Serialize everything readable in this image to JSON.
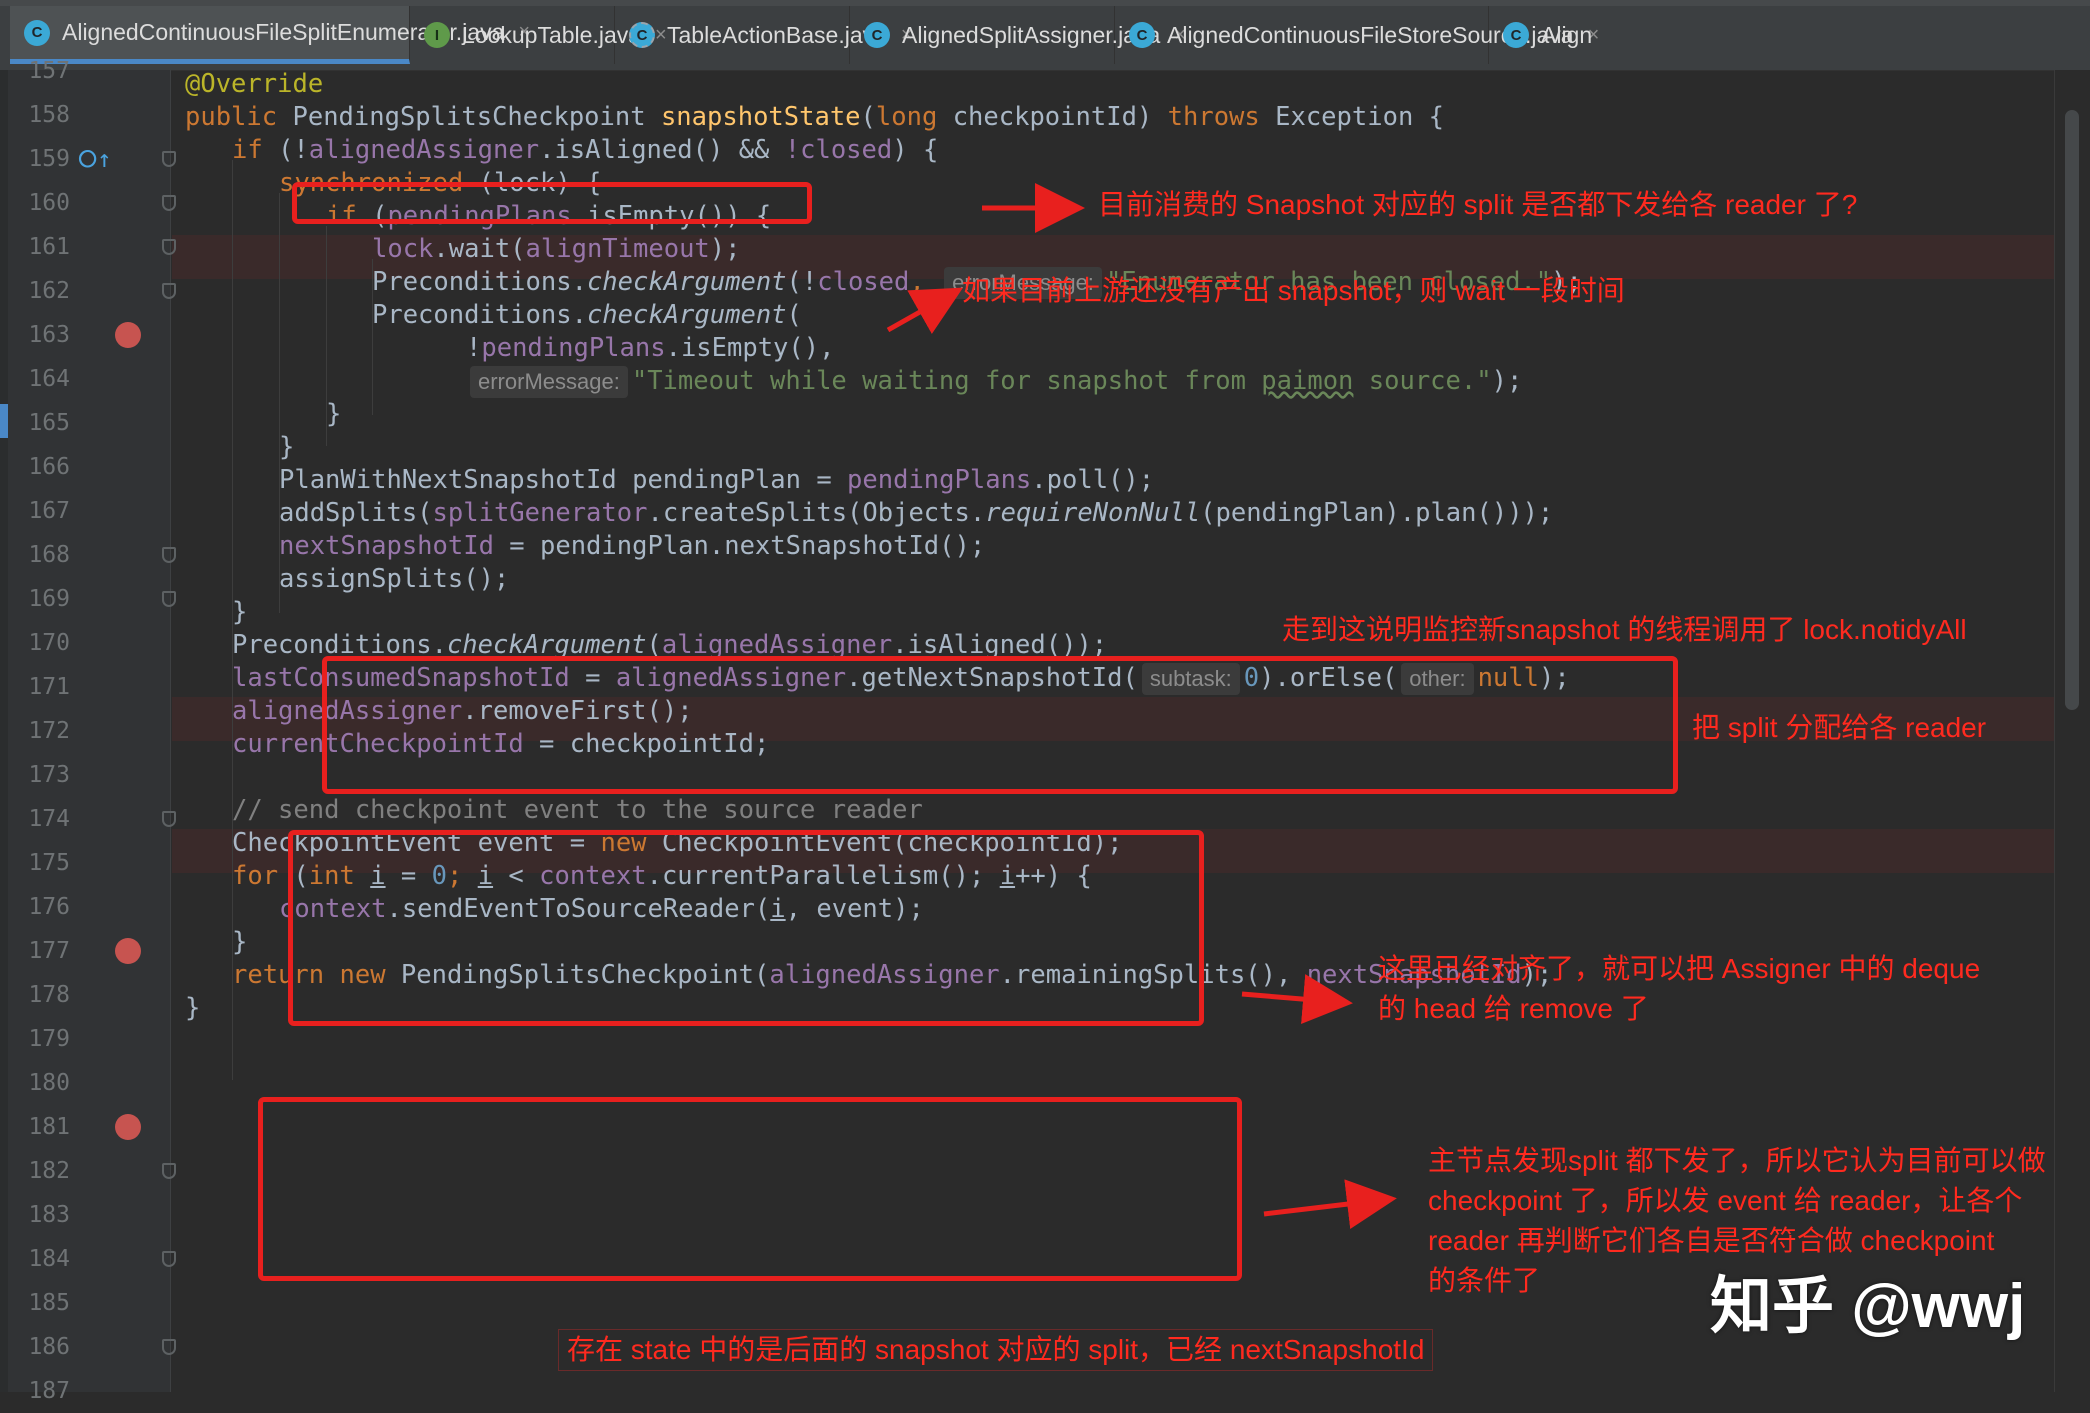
{
  "tabs": [
    {
      "label": "AlignedContinuousFileSplitEnumerator.java",
      "icon": "class-icon",
      "active": true,
      "closable": true
    },
    {
      "label": "LookupTable.java",
      "icon": "interface-icon",
      "active": false,
      "closable": true
    },
    {
      "label": "TableActionBase.java",
      "icon": "abstract-class-icon",
      "active": false,
      "closable": true
    },
    {
      "label": "AlignedSplitAssigner.java",
      "icon": "class-icon",
      "active": false,
      "closable": true
    },
    {
      "label": "AlignedContinuousFileStoreSource.java",
      "icon": "class-icon",
      "active": false,
      "closable": true
    },
    {
      "label": "Align",
      "icon": "class-icon",
      "active": false,
      "closable": false
    }
  ],
  "tab_close_symbol": "×",
  "editor": {
    "line_numbers": [
      "157",
      "158",
      "159",
      "160",
      "161",
      "162",
      "163",
      "164",
      "165",
      "166",
      "167",
      "168",
      "169",
      "170",
      "171",
      "172",
      "173",
      "174",
      "175",
      "176",
      "177",
      "178",
      "179",
      "180",
      "181",
      "182",
      "183",
      "184",
      "185",
      "186",
      "187"
    ],
    "breakpoint_lines": [
      "163",
      "177",
      "181"
    ],
    "override_marker_line": "159",
    "code": {
      "l158": {
        "annotation": "@Override"
      },
      "l159": {
        "kw_public": "public",
        "type": "PendingSplitsCheckpoint",
        "method": "snapshotState",
        "kw_long": "long",
        "param": "checkpointId)",
        "kw_throws": "throws",
        "rest": "Exception {"
      },
      "l160": {
        "kw_if": "if",
        "open": "(!",
        "field": "alignedAssigner",
        "call": ".isAligned()",
        "and": "&&",
        "closed": "!closed",
        "end": ") {"
      },
      "l161": {
        "kw": "synchronized",
        "rest": "(lock) {"
      },
      "l162": {
        "kw_if": "if",
        "open": "(",
        "field": "pendingPlans",
        "rest": ".isEmpty()) {"
      },
      "l163": {
        "field": "lock",
        "call": ".wait(",
        "arg": "alignTimeout",
        "end": ");"
      },
      "l164": {
        "cls": "Preconditions.",
        "method": "checkArgument",
        "open": "(!",
        "field": "closed",
        "comma": ",",
        "hint": "errorMessage:",
        "string": "\"Enumerator has been closed.\"",
        "end": ");"
      },
      "l165": {
        "cls": "Preconditions.",
        "method": "checkArgument",
        "open": "("
      },
      "l166": {
        "bang": "!",
        "field": "pendingPlans",
        "rest": ".isEmpty(),"
      },
      "l167": {
        "hint": "errorMessage:",
        "string_a": "\"Timeout while waiting for snapshot from ",
        "string_b": "paimon",
        "string_c": " source.\"",
        "end": ");"
      },
      "l168": {
        "text": "}"
      },
      "l169": {
        "text": "}"
      },
      "l170": {
        "decl": "PlanWithNextSnapshotId pendingPlan = ",
        "field": "pendingPlans",
        "rest": ".poll();"
      },
      "l171": {
        "call": "addSplits(",
        "field": "splitGenerator",
        "mid": ".createSplits(Objects.",
        "method": "requireNonNull",
        "rest": "(pendingPlan).plan()));"
      },
      "l172": {
        "field": "nextSnapshotId",
        "rest": " = pendingPlan.nextSnapshotId();"
      },
      "l173": {
        "text": "assignSplits();"
      },
      "l174": {
        "text": "}"
      },
      "l175": {
        "cls": "Preconditions.",
        "method": "checkArgument",
        "open": "(",
        "field": "alignedAssigner",
        "rest": ".isAligned());"
      },
      "l176": {
        "field": "lastConsumedSnapshotId",
        "eq": " = ",
        "field2": "alignedAssigner",
        "call": ".getNextSnapshotId(",
        "hint": "subtask:",
        "num": "0",
        "mid": ").orElse(",
        "hint2": "other:",
        "kw_null": "null",
        "end": ");"
      },
      "l177": {
        "field": "alignedAssigner",
        "rest": ".removeFirst();"
      },
      "l178": {
        "field": "currentCheckpointId",
        "rest": " = checkpointId;"
      },
      "l180": {
        "comment": "// send checkpoint event to the source reader"
      },
      "l181": {
        "decl": "CheckpointEvent event = ",
        "kw_new": "new",
        "rest": " CheckpointEvent(checkpointId);"
      },
      "l182": {
        "kw_for": "for",
        "open": " (",
        "kw_int": "int",
        "i1": "i",
        "eq": " = ",
        "num": "0",
        "semi": "; ",
        "i2": "i",
        "lt": " < ",
        "field": "context",
        "mid": ".currentParallelism(); ",
        "i3": "i",
        "end": "++) {"
      },
      "l183": {
        "field": "context",
        "call": ".sendEventToSourceReader(",
        "i": "i",
        "rest": ", event);"
      },
      "l184": {
        "text": "}"
      },
      "l185": {
        "kw_return": "return",
        "kw_new": "new",
        "cls": " PendingSplitsCheckpoint(",
        "field": "alignedAssigner",
        "mid": ".remainingSplits(), ",
        "field2": "nextSnapshotId",
        "end": ");"
      },
      "l186": {
        "text": "}"
      }
    }
  },
  "annotations": {
    "note1": "目前消费的 Snapshot 对应的 split 是否都下发给各 reader 了?",
    "note2": "如果目前上游还没有产出 snapshot，则 wait 一段时间",
    "note3": "走到这说明监控新snapshot 的线程调用了 lock.notidyAll",
    "note4": "把 split 分配给各 reader",
    "note5_line1": "这里已经对齐了，就可以把 Assigner 中的 deque",
    "note5_line2": "的 head 给 remove 了",
    "note6_line1": "主节点发现split 都下发了，所以它认为目前可以做",
    "note6_line2": "checkpoint 了，所以发 event 给 reader，让各个",
    "note6_line3": "reader 再判断它们各自是否符合做 checkpoint",
    "note6_line4": "的条件了",
    "note7": "存在 state 中的是后面的 snapshot 对应的 split，已经 nextSnapshotId",
    "annotation_color": "#e8201e"
  },
  "watermark": "知乎 @wwj"
}
